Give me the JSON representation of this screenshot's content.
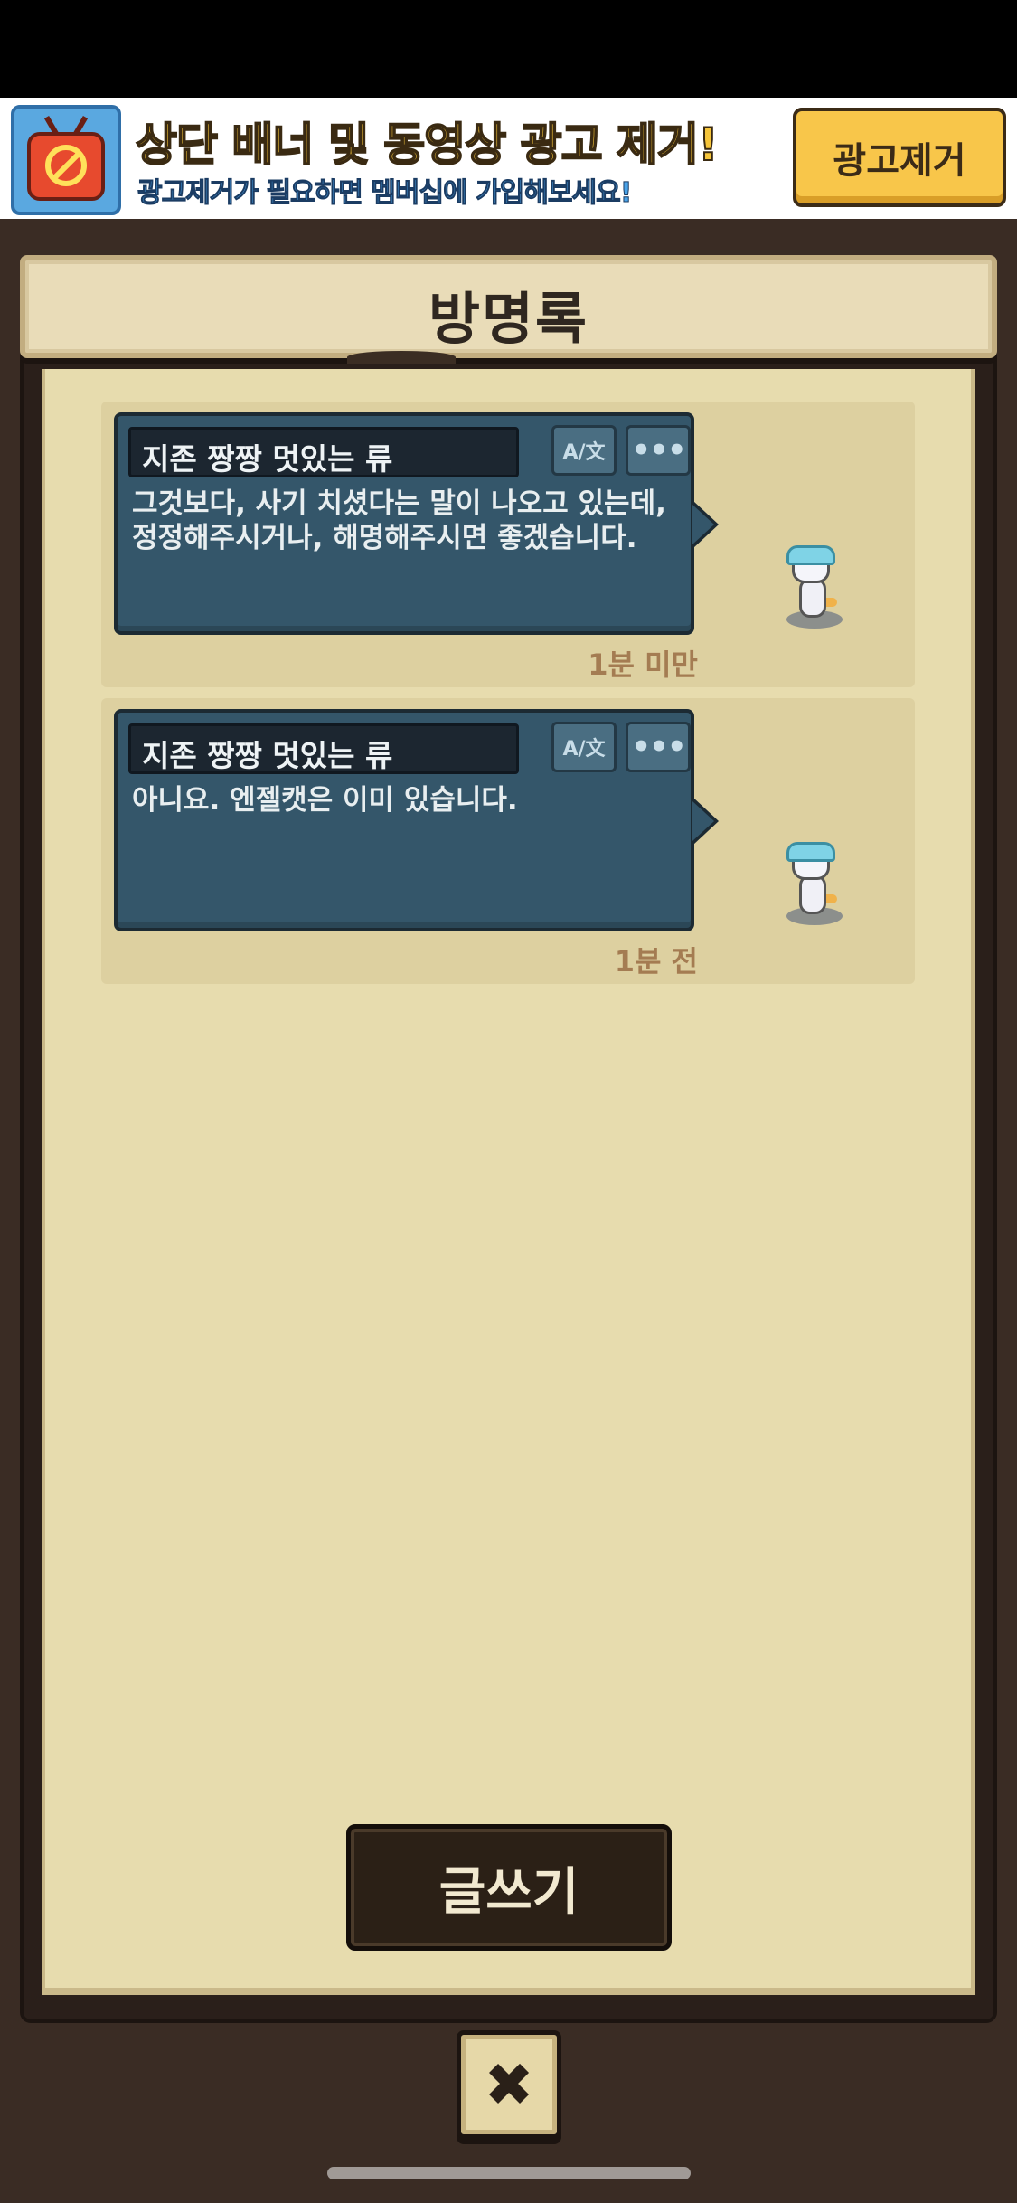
{
  "ad_banner": {
    "title": "상단 배너 및 동영상 광고 제거!",
    "subtitle": "광고제거가 필요하면 멤버십에 가입해보세요!",
    "remove_button": "광고제거",
    "icon": "no-ads-tv-icon"
  },
  "header": {
    "title": "방명록"
  },
  "entries": [
    {
      "author": "지존 짱짱 멋있는 류",
      "message_line1": "그것보다, 사기 치셨다는 말이 나오고 있는데,",
      "message_line2": "정정해주시거나, 해명해주시면 좋겠습니다.",
      "time": "1분 미만",
      "translate_icon": "A/文",
      "more_icon": "•••"
    },
    {
      "author": "지존 짱짱 멋있는 류",
      "message_line1": "아니요. 엔젤캣은 이미 있습니다.",
      "message_line2": "",
      "time": "1분 전",
      "translate_icon": "A/文",
      "more_icon": "•••"
    }
  ],
  "actions": {
    "write_button": "글쓰기",
    "close_icon": "✖"
  },
  "colors": {
    "bubble": "#34566a",
    "paper": "#e7dcae",
    "frame": "#2a1f1a",
    "time_text": "#a47c52"
  }
}
